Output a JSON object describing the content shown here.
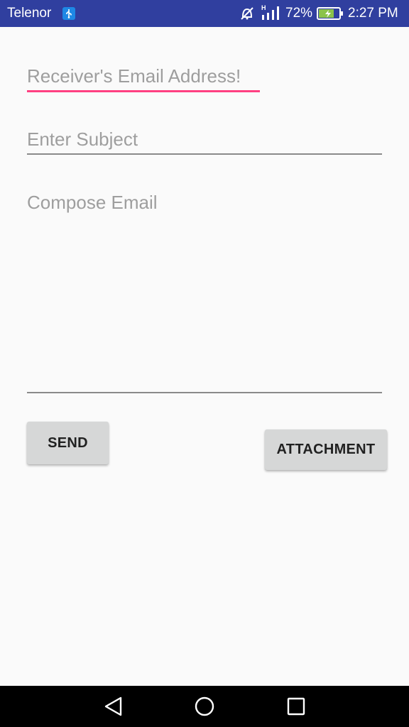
{
  "status_bar": {
    "carrier": "Telenor",
    "battery_percent": "72%",
    "time": "2:27 PM",
    "network_type": "H",
    "icons": [
      "usb-icon",
      "mute-icon",
      "signal-icon",
      "battery-charging-icon"
    ]
  },
  "form": {
    "to_placeholder": "Receiver's Email Address!",
    "subject_placeholder": "Enter Subject",
    "body_placeholder": "Compose Email"
  },
  "buttons": {
    "send_label": "SEND",
    "attachment_label": "ATTACHMENT"
  },
  "nav_bar": {
    "icons": [
      "back-icon",
      "home-icon",
      "recent-apps-icon"
    ]
  },
  "colors": {
    "status_bar": "#303f9f",
    "accent": "#ff4081",
    "background": "#fafafa",
    "button": "#d6d7d7",
    "hint_text": "#9e9e9e"
  }
}
